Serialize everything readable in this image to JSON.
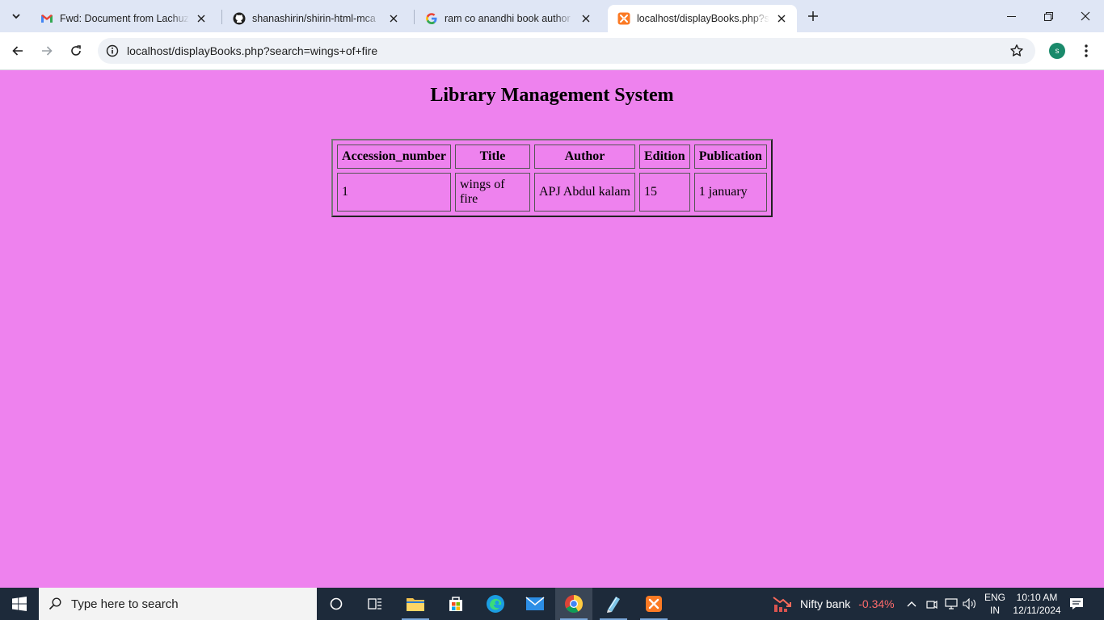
{
  "browser": {
    "tabs": [
      {
        "title": "Fwd: Document from Lachuzzzz",
        "favicon": "gmail-icon",
        "active": false
      },
      {
        "title": "shanashirin/shirin-html-mca",
        "favicon": "github-icon",
        "active": false
      },
      {
        "title": "ram co anandhi book author - Google",
        "favicon": "google-icon",
        "active": false
      },
      {
        "title": "localhost/displayBooks.php?search",
        "favicon": "xampp-icon",
        "active": true
      }
    ],
    "url": "localhost/displayBooks.php?search=wings+of+fire",
    "profile_initial": "s"
  },
  "page": {
    "title": "Library Management System",
    "table": {
      "headers": [
        "Accession_number",
        "Title",
        "Author",
        "Edition",
        "Publication"
      ],
      "rows": [
        [
          "1",
          "wings of fire",
          "APJ Abdul kalam",
          "15",
          "1 january"
        ]
      ]
    },
    "background_color": "#ee82ee"
  },
  "taskbar": {
    "search_placeholder": "Type here to search",
    "stock": {
      "name": "Nifty bank",
      "change": "-0.34%"
    },
    "language": {
      "line1": "ENG",
      "line2": "IN"
    },
    "clock": {
      "time": "10:10 AM",
      "date": "12/11/2024"
    }
  }
}
